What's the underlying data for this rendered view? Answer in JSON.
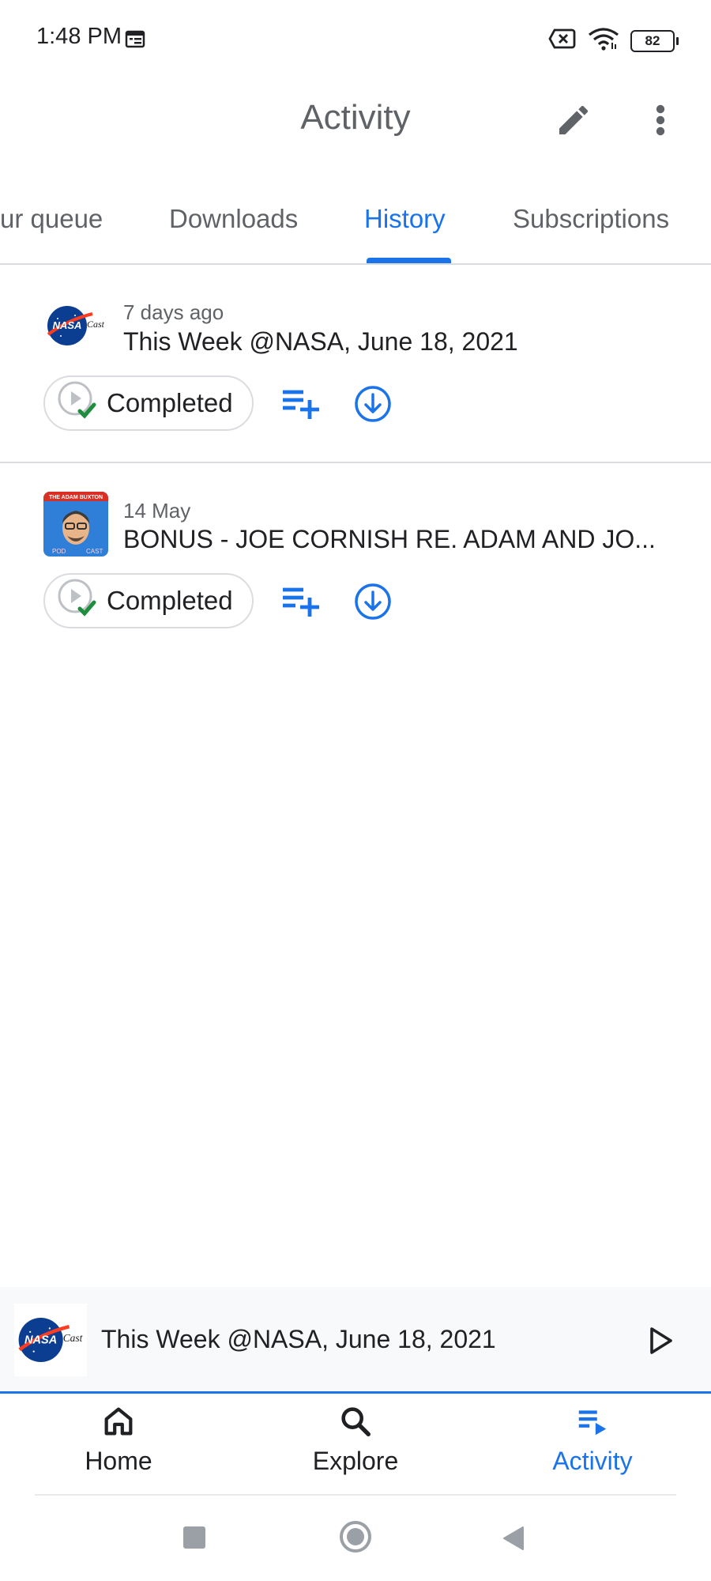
{
  "status_bar": {
    "time": "1:48 PM",
    "battery": "82",
    "icons": [
      "calendar-icon",
      "no-sim-icon",
      "wifi-icon",
      "battery-icon"
    ]
  },
  "app_bar": {
    "title": "Activity",
    "icons": [
      "edit-icon",
      "more-vert-icon"
    ]
  },
  "tabs": [
    {
      "label": "ur queue",
      "active": false
    },
    {
      "label": "Downloads",
      "active": false
    },
    {
      "label": "History",
      "active": true
    },
    {
      "label": "Subscriptions",
      "active": false
    }
  ],
  "episodes": [
    {
      "date": "7 days ago",
      "title": "This Week @NASA, June 18, 2021",
      "status": "Completed",
      "thumbnail": {
        "logo_text": "NASA",
        "logo_suffix": "Cast"
      }
    },
    {
      "date": "14 May",
      "title": "BONUS - JOE CORNISH RE. ADAM AND JO...",
      "status": "Completed",
      "thumbnail": {
        "header": "THE ADAM BUXTON",
        "left": "POD",
        "right": "CAST"
      }
    }
  ],
  "mini_player": {
    "title": "This Week @NASA, June 18, 2021",
    "thumbnail": {
      "logo_text": "NASA",
      "logo_suffix": "Cast"
    }
  },
  "bottom_nav": [
    {
      "label": "Home",
      "icon": "home-icon",
      "active": false
    },
    {
      "label": "Explore",
      "icon": "search-icon",
      "active": false
    },
    {
      "label": "Activity",
      "icon": "playlist-play-icon",
      "active": true
    }
  ],
  "colors": {
    "accent": "#1a73e8",
    "check": "#1e8e3e",
    "text_primary": "#202124",
    "text_secondary": "#5f6368"
  }
}
